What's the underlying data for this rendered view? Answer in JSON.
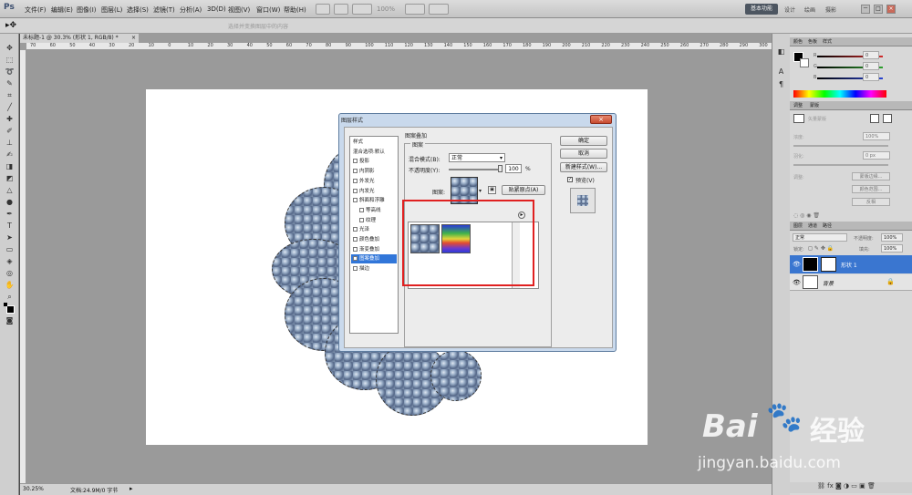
{
  "menubar": {
    "logo": "Ps",
    "items": [
      "文件(F)",
      "编辑(E)",
      "图像(I)",
      "图层(L)",
      "选择(S)",
      "滤镜(T)",
      "分析(A)",
      "3D(D)",
      "视图(V)",
      "窗口(W)",
      "帮助(H)"
    ],
    "zoom": "100%",
    "workspace_active": "基本功能",
    "workspace_other": [
      "设计",
      "绘画",
      "摄影"
    ],
    "window_controls": [
      "－",
      "□",
      "×"
    ]
  },
  "optionsbar": {
    "hint": "选择并变换图层中的内容"
  },
  "document": {
    "tab_title": "未标题-1 @ 30.3% (形状 1, RGB/8) *",
    "tab_close": "×",
    "ruler_numbers": [
      "70",
      "60",
      "50",
      "40",
      "30",
      "20",
      "10",
      "0",
      "10",
      "20",
      "30",
      "40",
      "50",
      "60",
      "70",
      "80",
      "90",
      "100",
      "110",
      "120",
      "130",
      "140",
      "150",
      "160",
      "170",
      "180",
      "190",
      "200",
      "210",
      "220",
      "230",
      "240",
      "250",
      "260",
      "270",
      "280",
      "290",
      "300"
    ],
    "status_zoom": "30.25%",
    "status_doc": "文档:24.9M/0 字节"
  },
  "color_panel": {
    "tabs": [
      "颜色",
      "色板",
      "样式"
    ],
    "rows": [
      {
        "label": "R",
        "value": "0",
        "color": "#d22b2b"
      },
      {
        "label": "G",
        "value": "0",
        "color": "#2ea12e"
      },
      {
        "label": "B",
        "value": "0",
        "color": "#2b45d2"
      }
    ]
  },
  "adjust_panel": {
    "tabs": [
      "调整",
      "蒙版"
    ],
    "title": "矢量蒙版",
    "density_label": "浓度:",
    "density_value": "100%",
    "feather_label": "羽化:",
    "feather_value": "0 px",
    "refine_label": "调整:",
    "buttons": [
      "蒙版边缘...",
      "颜色范围...",
      "反相"
    ]
  },
  "layers_panel": {
    "tabs": [
      "图层",
      "通道",
      "路径"
    ],
    "blend_mode": "正常",
    "opacity_label": "不透明度:",
    "opacity": "100%",
    "lock_label": "锁定:",
    "fill_label": "填充:",
    "fill": "100%",
    "layers": [
      {
        "name": "形状 1",
        "selected": true
      },
      {
        "name": "背景",
        "selected": false
      }
    ]
  },
  "dialog": {
    "title": "图层样式",
    "close": "×",
    "styles": [
      {
        "label": "样式",
        "checkbox": false,
        "checked": false,
        "selected": false,
        "sub": false
      },
      {
        "label": "混合选项:默认",
        "checkbox": false,
        "checked": false,
        "selected": false,
        "sub": false
      },
      {
        "label": "投影",
        "checkbox": true,
        "checked": false,
        "selected": false,
        "sub": false
      },
      {
        "label": "内阴影",
        "checkbox": true,
        "checked": false,
        "selected": false,
        "sub": false
      },
      {
        "label": "外发光",
        "checkbox": true,
        "checked": false,
        "selected": false,
        "sub": false
      },
      {
        "label": "内发光",
        "checkbox": true,
        "checked": false,
        "selected": false,
        "sub": false
      },
      {
        "label": "斜面和浮雕",
        "checkbox": true,
        "checked": false,
        "selected": false,
        "sub": false
      },
      {
        "label": "等高线",
        "checkbox": true,
        "checked": false,
        "selected": false,
        "sub": true
      },
      {
        "label": "纹理",
        "checkbox": true,
        "checked": false,
        "selected": false,
        "sub": true
      },
      {
        "label": "光泽",
        "checkbox": true,
        "checked": false,
        "selected": false,
        "sub": false
      },
      {
        "label": "颜色叠加",
        "checkbox": true,
        "checked": false,
        "selected": false,
        "sub": false
      },
      {
        "label": "渐变叠加",
        "checkbox": true,
        "checked": false,
        "selected": false,
        "sub": false
      },
      {
        "label": "图案叠加",
        "checkbox": true,
        "checked": true,
        "selected": true,
        "sub": false
      },
      {
        "label": "描边",
        "checkbox": true,
        "checked": false,
        "selected": false,
        "sub": false
      }
    ],
    "section_title": "图案叠加",
    "group_title": "图案",
    "blend_label": "混合模式(B):",
    "blend_value": "正常",
    "opacity_label": "不透明度(Y):",
    "opacity_value": "100",
    "percent": "%",
    "pattern_label": "图案:",
    "snap_button": "贴紧原点(A)",
    "ok": "确定",
    "cancel": "取消",
    "new_style": "新建样式(W)...",
    "preview_label": "预览(V)",
    "picker_arrow": "▸"
  },
  "watermark": {
    "brand": "Bai",
    "brand2": "经验",
    "url": "jingyan.baidu.com"
  }
}
